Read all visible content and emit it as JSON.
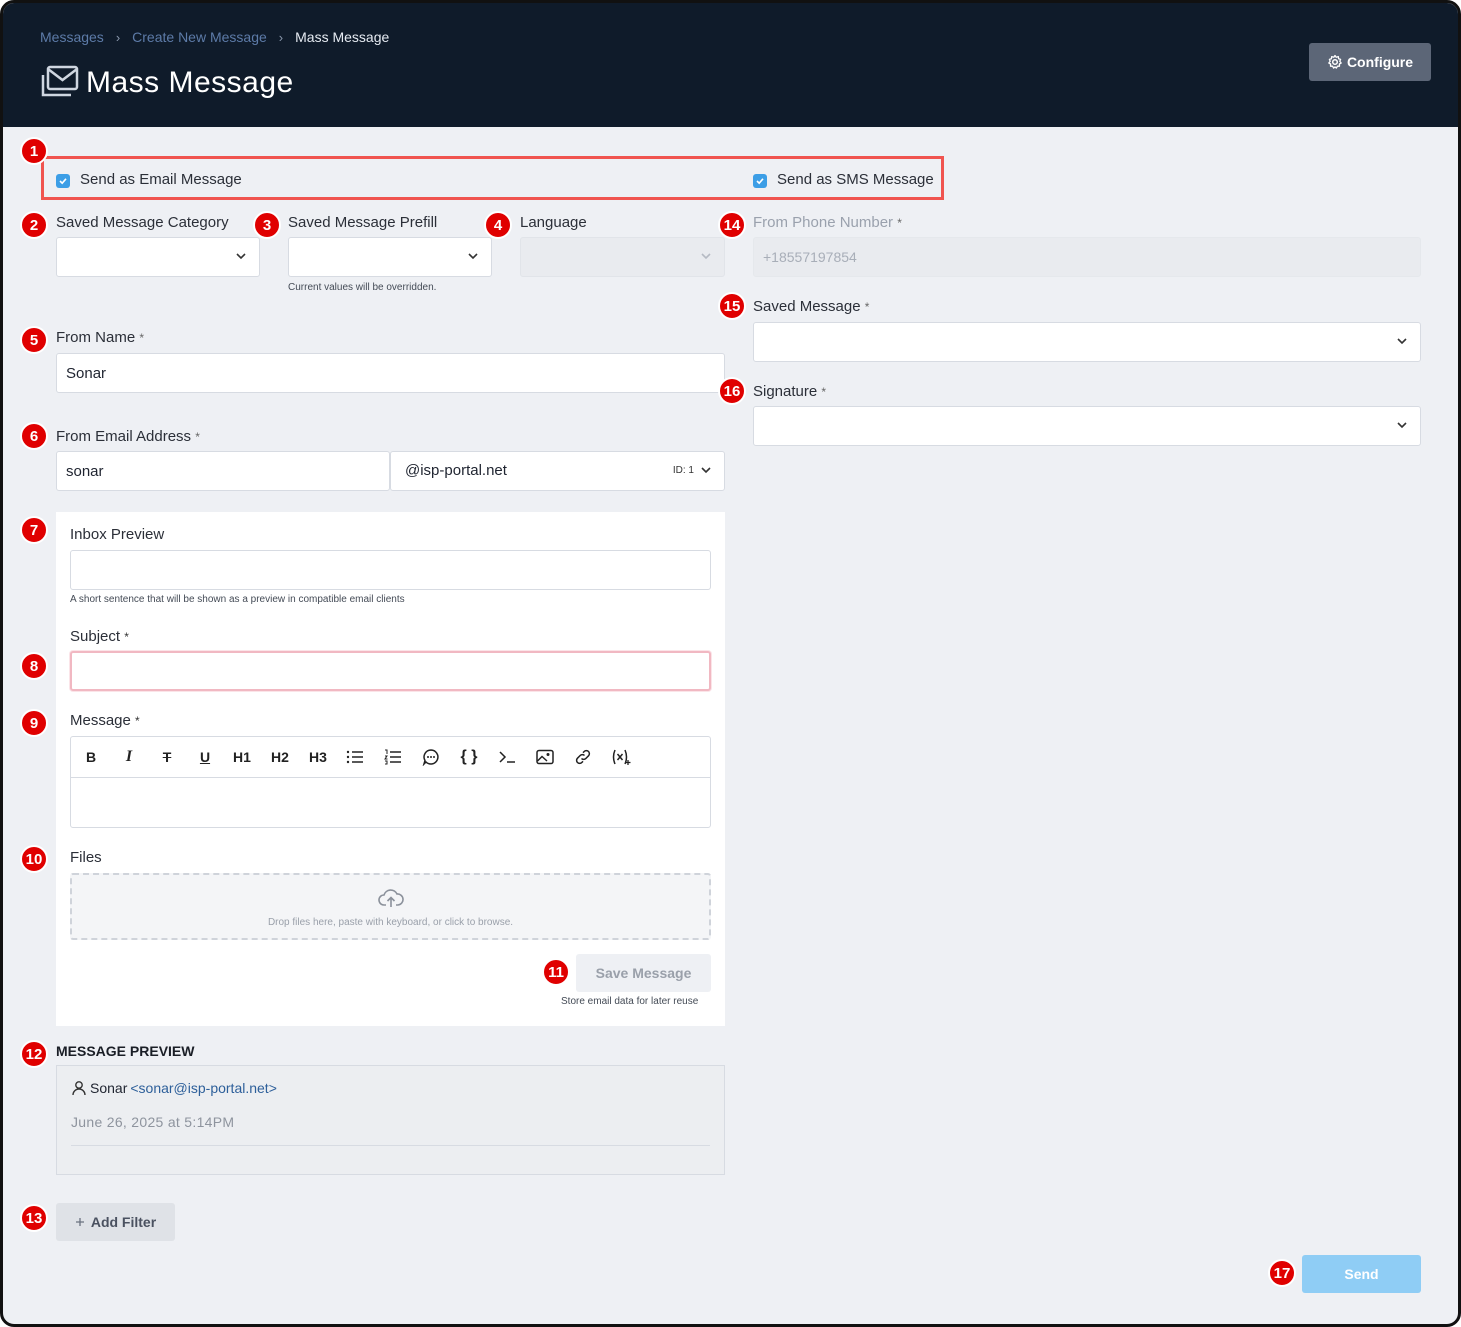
{
  "breadcrumb": {
    "items": [
      "Messages",
      "Create New Message"
    ],
    "separator": "›",
    "current": "Mass Message"
  },
  "header": {
    "title": "Mass Message",
    "configure_label": "Configure"
  },
  "markers": [
    "1",
    "2",
    "3",
    "4",
    "5",
    "6",
    "7",
    "8",
    "9",
    "10",
    "11",
    "12",
    "13",
    "14",
    "15",
    "16",
    "17"
  ],
  "send_as": {
    "email_label": "Send as Email Message",
    "email_checked": true,
    "sms_label": "Send as SMS Message",
    "sms_checked": true
  },
  "fields": {
    "saved_message_category": {
      "label": "Saved Message Category",
      "value": ""
    },
    "saved_message_prefill": {
      "label": "Saved Message Prefill",
      "value": "",
      "hint": "Current values will be overridden."
    },
    "language": {
      "label": "Language",
      "value": "",
      "disabled": true
    },
    "from_name": {
      "label": "From Name",
      "required": "*",
      "value": "Sonar"
    },
    "from_email": {
      "label": "From Email Address",
      "required": "*",
      "local_part": "sonar",
      "domain": "@isp-portal.net",
      "domain_id": "ID: 1"
    },
    "from_phone": {
      "label": "From Phone Number",
      "required": "*",
      "value": "+18557197854",
      "disabled": true
    },
    "saved_message": {
      "label": "Saved Message",
      "required": "*",
      "value": ""
    },
    "signature": {
      "label": "Signature",
      "required": "*",
      "value": ""
    }
  },
  "email_panel": {
    "inbox_preview": {
      "label": "Inbox Preview",
      "value": "",
      "hint": "A short sentence that will be shown as a preview in compatible email clients"
    },
    "subject": {
      "label": "Subject",
      "required": "*",
      "value": ""
    },
    "message": {
      "label": "Message",
      "required": "*",
      "toolbar": [
        {
          "name": "bold-button",
          "text": "B"
        },
        {
          "name": "italic-button",
          "text": "I"
        },
        {
          "name": "strikethrough-button",
          "text": "T"
        },
        {
          "name": "underline-button",
          "text": "U"
        },
        {
          "name": "heading1-button",
          "text": "H1"
        },
        {
          "name": "heading2-button",
          "text": "H2"
        },
        {
          "name": "heading3-button",
          "text": "H3"
        },
        {
          "name": "bullet-list-button",
          "icon": "bullet-list-icon"
        },
        {
          "name": "ordered-list-button",
          "icon": "ordered-list-icon"
        },
        {
          "name": "blockquote-button",
          "icon": "speech-bubble-icon"
        },
        {
          "name": "code-block-button",
          "text": "{ }"
        },
        {
          "name": "inline-code-button",
          "icon": "terminal-icon"
        },
        {
          "name": "image-button",
          "icon": "image-icon"
        },
        {
          "name": "link-button",
          "icon": "link-icon"
        },
        {
          "name": "variable-button",
          "icon": "variable-icon"
        }
      ]
    },
    "files": {
      "label": "Files",
      "dropzone_text": "Drop files here, paste with keyboard, or click to browse."
    },
    "save_message": {
      "label": "Save Message",
      "hint": "Store email data for later reuse"
    }
  },
  "preview": {
    "heading": "MESSAGE PREVIEW",
    "sender_name": "Sonar",
    "sender_email": "<sonar@isp-portal.net>",
    "date": "June 26, 2025 at 5:14PM"
  },
  "actions": {
    "add_filter": "Add Filter",
    "send": "Send"
  },
  "colors": {
    "header_bg": "#0f1b2a",
    "marker": "#e00000",
    "highlight_border": "#f0544f",
    "checkbox": "#3c9ee6",
    "send_button": "#8fcdf5"
  }
}
